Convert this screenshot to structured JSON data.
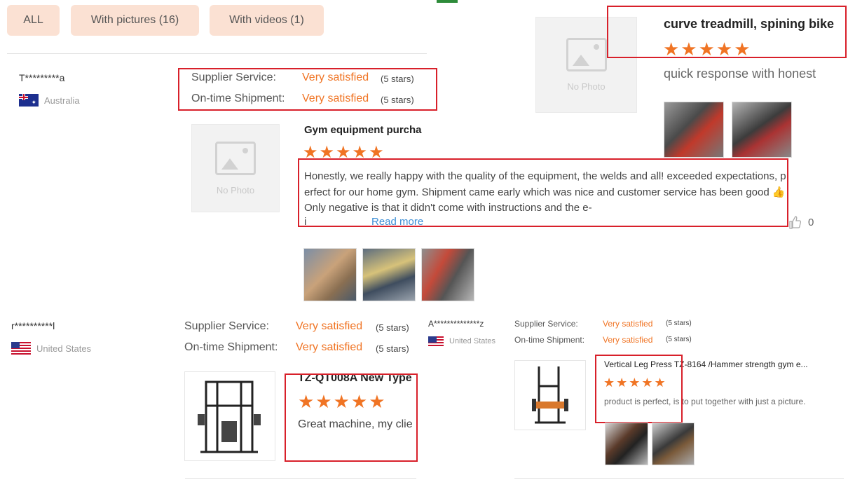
{
  "filters": {
    "all": "ALL",
    "with_pictures": "With pictures (16)",
    "with_videos": "With videos (1)"
  },
  "labels": {
    "supplier_service": "Supplier Service:",
    "on_time_shipment": "On-time Shipment:",
    "very_satisfied": "Very satisfied",
    "five_stars": "(5 stars)",
    "no_photo": "No Photo",
    "read_more": "Read more"
  },
  "stars_glyph": "★★★★★",
  "reviews": [
    {
      "user": "T*********a",
      "country": "Australia",
      "product_title": "Gym equipment purcha",
      "text": "Honestly, we really happy with the quality of the equipment, the welds and all! exceeded expectations, perfect for our home gym. Shipment came early which was nice and customer service has been good 👍 Only negative is that it didn't come with instructions and the e-",
      "text_tail": "i",
      "likes": "0"
    },
    {
      "product_title": "curve treadmill, spining bike",
      "text": "quick response with honest"
    },
    {
      "user": "r**********l",
      "country": "United States",
      "product_title": "TZ-QT008A New Type",
      "text": "Great machine, my clie"
    },
    {
      "user": "A**************z",
      "country": "United States",
      "product_title": "Vertical Leg Press TZ-8164 /Hammer strength gym e...",
      "text": "product is perfect, is to put together with just a picture."
    }
  ],
  "colors": {
    "accent": "#f07424",
    "filter_bg": "#fbe1d3",
    "highlight_box": "#d8202a",
    "link": "#3b8ed6"
  }
}
